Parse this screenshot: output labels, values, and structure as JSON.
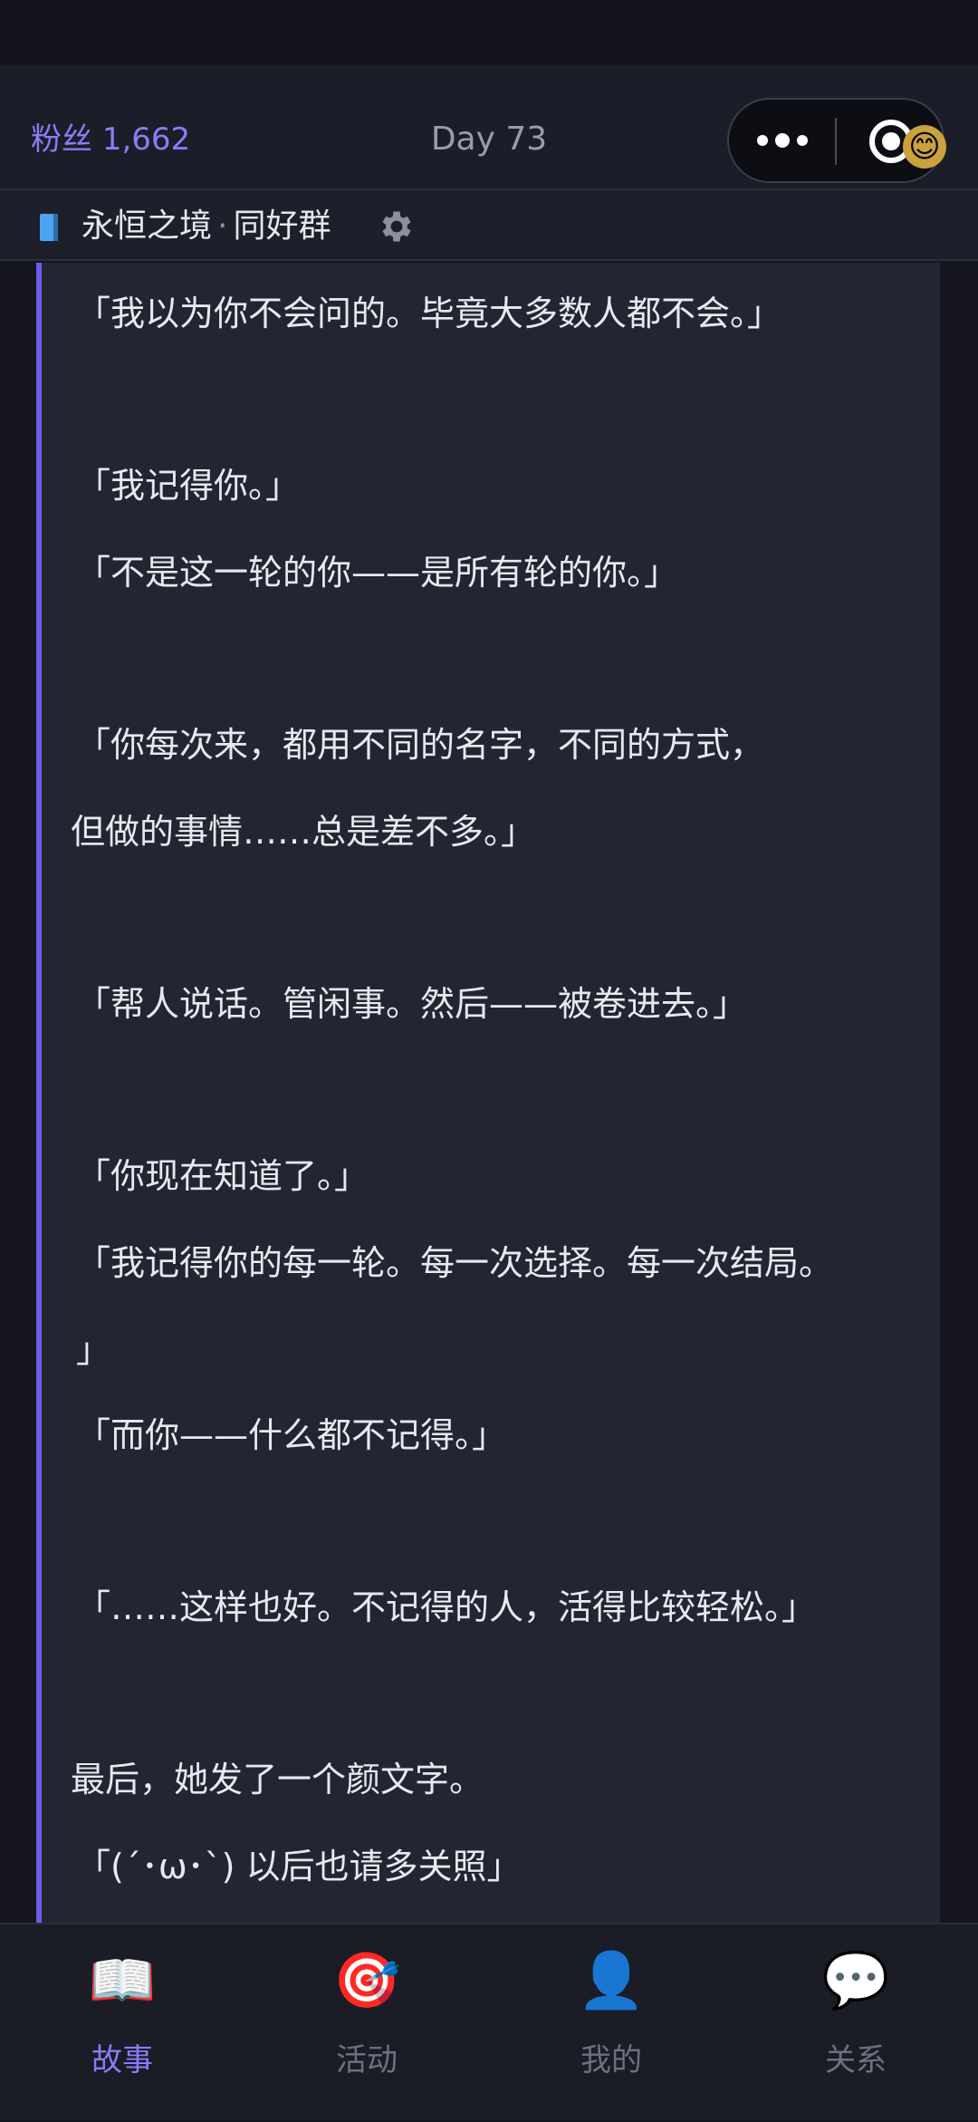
{
  "header": {
    "fans": "粉丝 1,662",
    "day": "Day 73",
    "avatar_emoji": "😊"
  },
  "subheader": {
    "group_title": "永恒之境",
    "separator": "·",
    "group_type": "同好群",
    "icon": "gear-icon"
  },
  "story": {
    "lines": [
      "「我以为你不会问的。毕竟大多数人都不会。」",
      "「我记得你。」",
      "「不是这一轮的你——是所有轮的你。」",
      "「你每次来，都用不同的名字，不同的方式，",
      "但做的事情……总是差不多。」",
      "「帮人说话。管闲事。然后——被卷进去。」",
      "「你现在知道了。」",
      "「我记得你的每一轮。每一次选择。每一次结局。",
      "」",
      "「而你——什么都不记得。」",
      "「……这样也好。不记得的人，活得比较轻松。」",
      "最后，她发了一个颜文字。",
      "「(´･ω･`) 以后也请多关照」"
    ]
  },
  "tabs": [
    {
      "label": "故事",
      "icon": "📖",
      "active": true
    },
    {
      "label": "活动",
      "icon": "🎯",
      "active": false
    },
    {
      "label": "我的",
      "icon": "👤",
      "active": false
    },
    {
      "label": "关系",
      "icon": "💬",
      "active": false
    }
  ],
  "colors": {
    "accent": "#8b7cf6",
    "panel_border": "#6c5ce7",
    "background": "#15161f"
  }
}
